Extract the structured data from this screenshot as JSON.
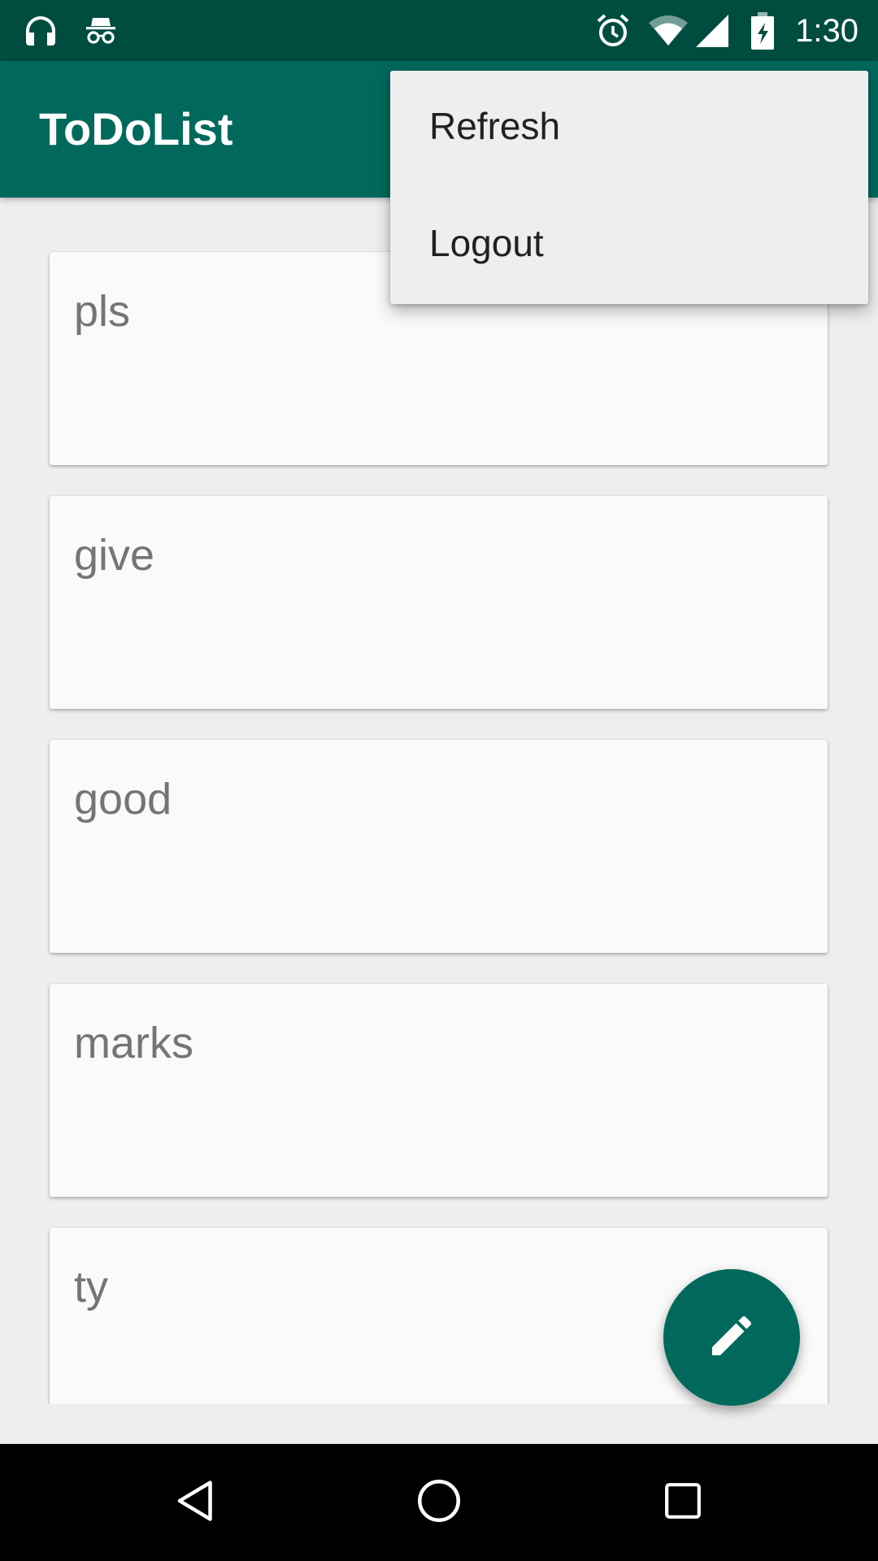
{
  "status_bar": {
    "time": "1:30",
    "left_icons": [
      "headphones-icon",
      "incognito-icon"
    ],
    "right_icons": [
      "alarm-icon",
      "wifi-icon",
      "signal-icon",
      "battery-charging-icon"
    ]
  },
  "app_bar": {
    "title": "ToDoList"
  },
  "todo_list": {
    "items": [
      {
        "text": "pls"
      },
      {
        "text": "give"
      },
      {
        "text": "good"
      },
      {
        "text": "marks"
      },
      {
        "text": "ty"
      }
    ]
  },
  "overflow_menu": {
    "items": [
      {
        "label": "Refresh"
      },
      {
        "label": "Logout"
      }
    ]
  },
  "fab": {
    "icon": "edit-icon"
  },
  "nav_bar": {
    "buttons": [
      "back-icon",
      "home-icon",
      "recents-icon"
    ]
  },
  "colors": {
    "primary": "#00695c",
    "primary_dark": "#004d40",
    "background": "#eeeeee",
    "card": "#fafafa",
    "card_text": "#757575",
    "menu_text": "#212121"
  }
}
